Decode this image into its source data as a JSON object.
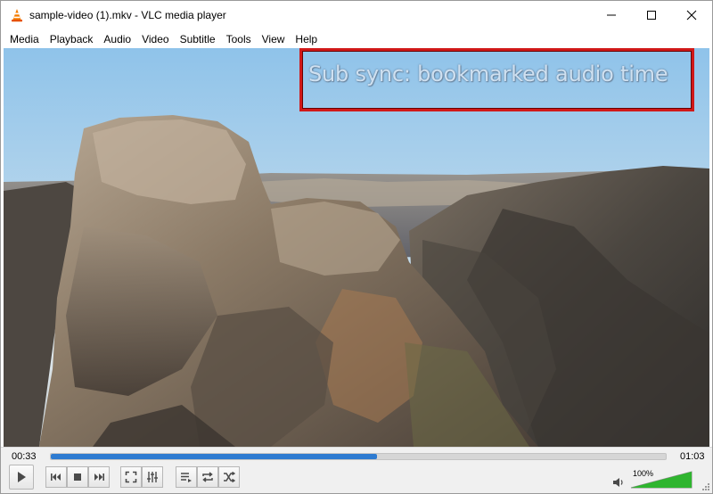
{
  "window": {
    "title": "sample-video (1).mkv - VLC media player"
  },
  "menu": {
    "items": [
      "Media",
      "Playback",
      "Audio",
      "Video",
      "Subtitle",
      "Tools",
      "View",
      "Help"
    ]
  },
  "video": {
    "osd_message": "Sub sync: bookmarked audio time",
    "highlight_color": "#d01818"
  },
  "playback": {
    "elapsed": "00:33",
    "duration": "01:03",
    "progress_fraction": 0.53,
    "progress_color": "#2e7bd1"
  },
  "audio": {
    "volume_label": "100%",
    "volume_fraction": 1.0,
    "volume_color": "#2fb52f"
  },
  "icons": {
    "app": "vlc-cone-icon",
    "play": "play-icon",
    "previous": "skip-previous-icon",
    "stop": "stop-icon",
    "next": "skip-next-icon",
    "fullscreen": "fullscreen-icon",
    "extended": "equalizer-icon",
    "playlist": "playlist-icon",
    "loop": "loop-icon",
    "random": "shuffle-icon",
    "volume": "speaker-icon"
  }
}
